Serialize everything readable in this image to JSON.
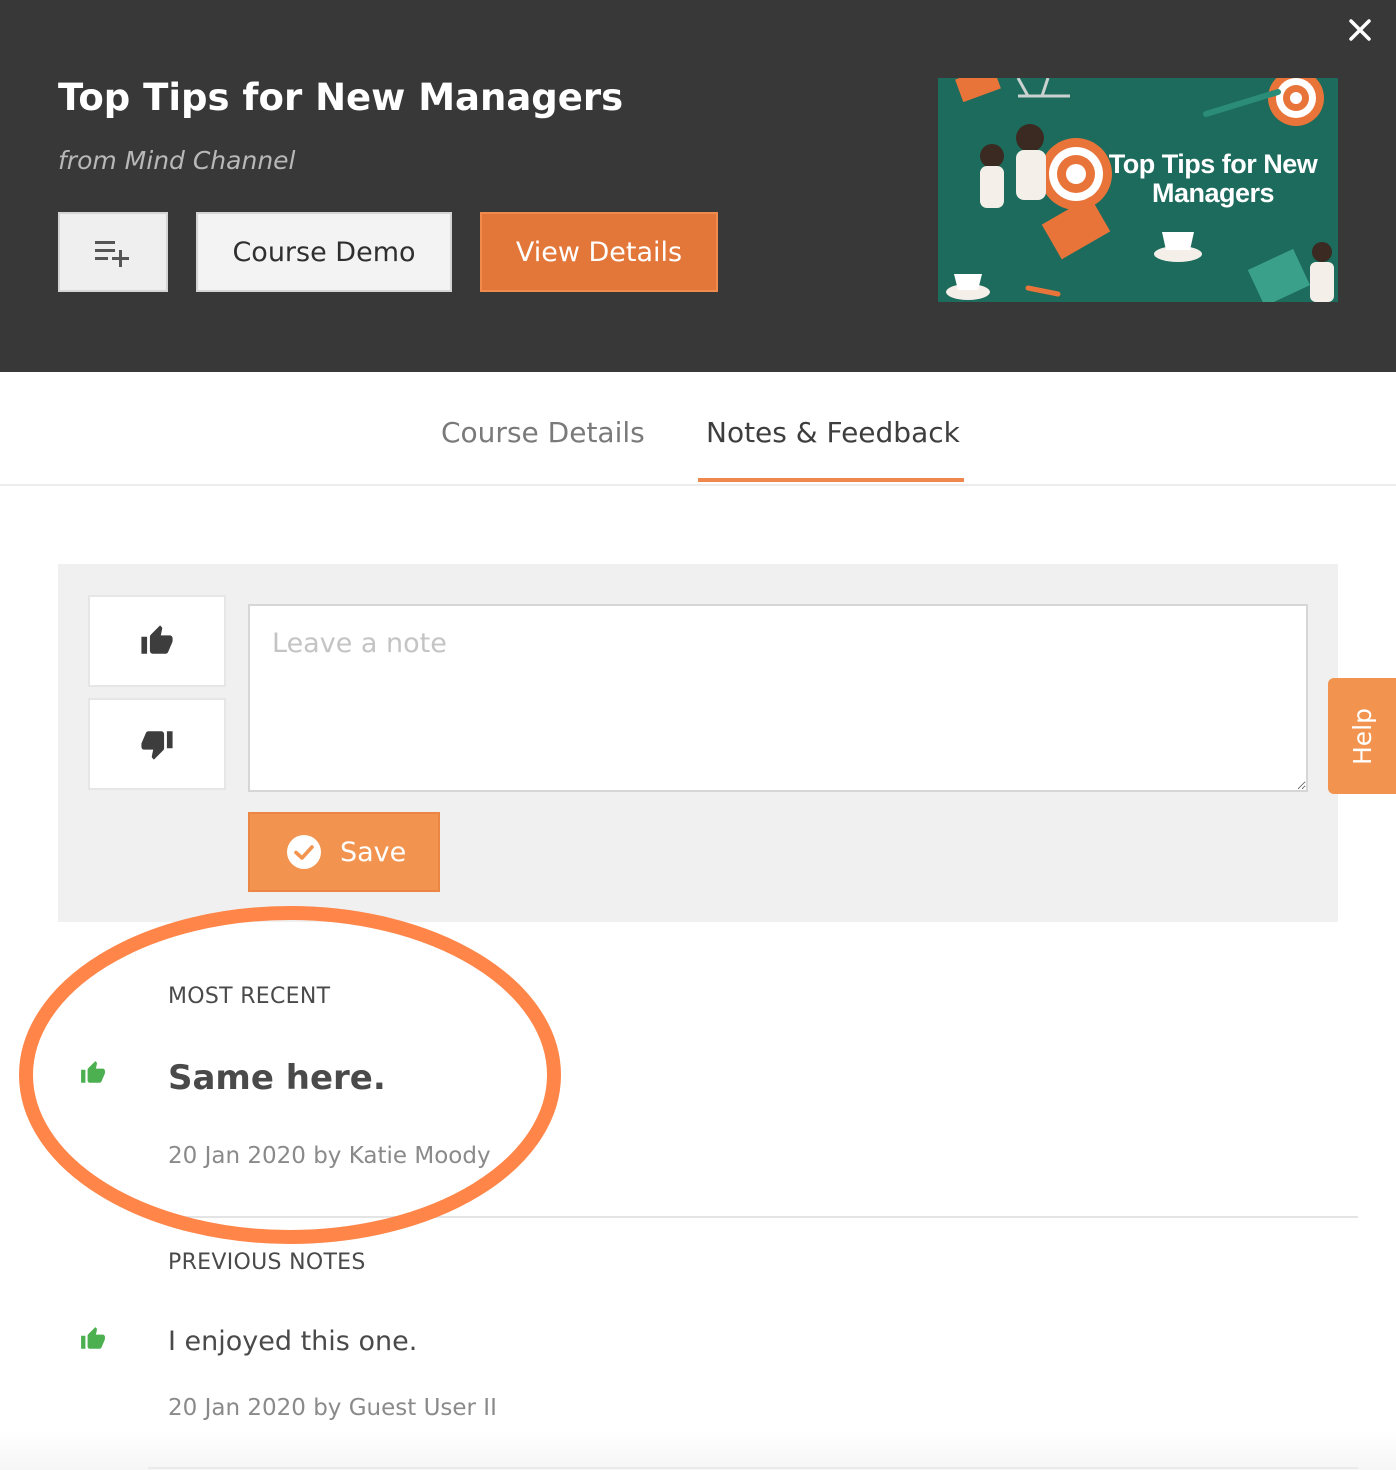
{
  "header": {
    "title": "Top Tips for New Managers",
    "provider": "from Mind Channel",
    "buttons": {
      "playlist_icon": "playlist-add-icon",
      "demo_label": "Course Demo",
      "details_label": "View Details"
    },
    "close_icon": "close-icon",
    "thumbnail": {
      "caption": "Top Tips for New Managers"
    }
  },
  "tabs": [
    {
      "label": "Course Details",
      "active": false
    },
    {
      "label": "Notes & Feedback",
      "active": true
    }
  ],
  "note_form": {
    "placeholder": "Leave a note",
    "value": "",
    "thumbs_up_icon": "thumbs-up-icon",
    "thumbs_down_icon": "thumbs-down-icon",
    "save_label": "Save",
    "save_icon": "check-circle-icon"
  },
  "help": {
    "label": "Help"
  },
  "notes": {
    "most_recent_heading": "MOST RECENT",
    "most_recent": {
      "text": "Same here.",
      "meta": "20 Jan 2020 by Katie Moody",
      "sentiment": "positive"
    },
    "previous_heading": "PREVIOUS NOTES",
    "previous": [
      {
        "text": "I enjoyed this one.",
        "meta": "20 Jan 2020 by Guest User II",
        "sentiment": "positive"
      }
    ]
  },
  "colors": {
    "header_bg": "#383838",
    "accent_orange": "#e3773a",
    "save_orange": "#f2944f",
    "positive_green": "#4caf50",
    "annotation_ring": "#ff8548"
  }
}
